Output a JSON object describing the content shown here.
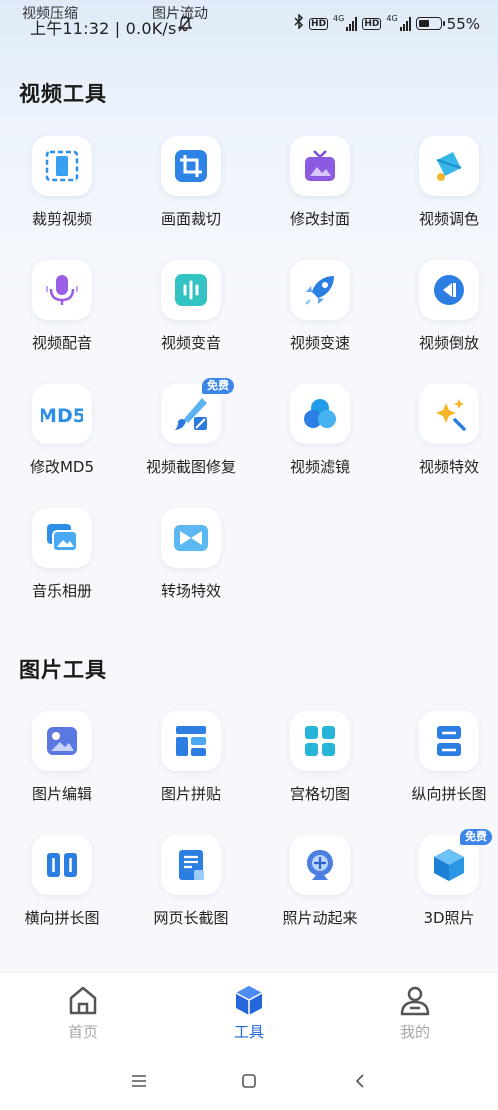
{
  "status_bar": {
    "ghost_left": "视频压缩",
    "ghost_right": "图片流动",
    "time_speed": "上午11:32 | 0.0K/s",
    "signal_1": "4G",
    "signal_2": "4G",
    "hd": "HD",
    "battery": "55%",
    "battery_level": 0.55
  },
  "video_section": {
    "title": "视频工具",
    "tools": [
      {
        "label": "裁剪视频",
        "icon": "film-crop-icon"
      },
      {
        "label": "画面裁切",
        "icon": "crop-icon"
      },
      {
        "label": "修改封面",
        "icon": "tv-cover-icon"
      },
      {
        "label": "视频调色",
        "icon": "paint-bucket-icon"
      },
      {
        "label": "视频配音",
        "icon": "microphone-icon"
      },
      {
        "label": "视频变音",
        "icon": "audio-wave-icon"
      },
      {
        "label": "视频变速",
        "icon": "rocket-icon"
      },
      {
        "label": "视频倒放",
        "icon": "rewind-icon"
      },
      {
        "label": "修改MD5",
        "icon": "md5-icon",
        "icon_text": "MD5"
      },
      {
        "label": "视频截图修复",
        "icon": "brush-repair-icon",
        "badge": "免费"
      },
      {
        "label": "视频滤镜",
        "icon": "filter-circles-icon"
      },
      {
        "label": "视频特效",
        "icon": "magic-wand-icon"
      },
      {
        "label": "音乐相册",
        "icon": "photo-album-icon"
      },
      {
        "label": "转场特效",
        "icon": "transition-icon"
      }
    ]
  },
  "image_section": {
    "title": "图片工具",
    "tools": [
      {
        "label": "图片编辑",
        "icon": "image-edit-icon"
      },
      {
        "label": "图片拼贴",
        "icon": "collage-icon"
      },
      {
        "label": "宫格切图",
        "icon": "grid-cut-icon"
      },
      {
        "label": "纵向拼长图",
        "icon": "vertical-stitch-icon"
      },
      {
        "label": "横向拼长图",
        "icon": "horizontal-stitch-icon"
      },
      {
        "label": "网页长截图",
        "icon": "web-screenshot-icon"
      },
      {
        "label": "照片动起来",
        "icon": "animate-photo-icon"
      },
      {
        "label": "3D照片",
        "icon": "cube-3d-icon",
        "badge": "免费"
      }
    ]
  },
  "bottom_nav": {
    "items": [
      {
        "label": "首页",
        "icon": "home-icon",
        "active": false
      },
      {
        "label": "工具",
        "icon": "toolbox-cube-icon",
        "active": true
      },
      {
        "label": "我的",
        "icon": "user-icon",
        "active": false
      }
    ],
    "active_color": "#2367db",
    "inactive_color": "#a7a7a7"
  },
  "system_nav": {
    "buttons": [
      "menu-icon",
      "home-square-icon",
      "back-icon"
    ]
  },
  "colors": {
    "accent": "#3b86e8",
    "badge": "#3b86e8"
  }
}
